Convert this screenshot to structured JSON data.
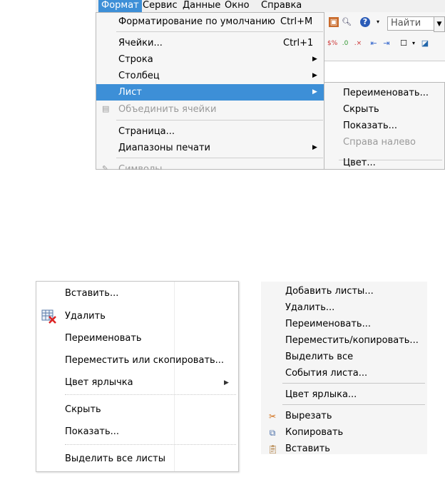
{
  "panel1": {
    "menubar": [
      {
        "label": "Формат",
        "active": true
      },
      {
        "label": "Сервис"
      },
      {
        "label": "Данные"
      },
      {
        "label": "Окно"
      },
      {
        "label": "Справка"
      }
    ],
    "find_placeholder": "Найти",
    "menu_items": [
      {
        "label": "Форматирование по умолчанию",
        "shortcut": "Ctrl+M"
      },
      {
        "label": "Ячейки...",
        "shortcut": "Ctrl+1"
      },
      {
        "label": "Строка"
      },
      {
        "label": "Столбец"
      },
      {
        "label": "Лист"
      },
      {
        "label": "Объединить ячейки"
      },
      {
        "label": "Страница..."
      },
      {
        "label": "Диапазоны печати"
      },
      {
        "label": "Символы"
      }
    ],
    "submenu_items": [
      {
        "label": "Переименовать..."
      },
      {
        "label": "Скрыть"
      },
      {
        "label": "Показать..."
      },
      {
        "label": "Справа налево"
      },
      {
        "label": "Цвет..."
      }
    ]
  },
  "panel2": {
    "items": [
      {
        "label": "Вставить..."
      },
      {
        "label": "Удалить"
      },
      {
        "label": "Переименовать"
      },
      {
        "label": "Переместить или скопировать..."
      },
      {
        "label": "Цвет ярлычка"
      },
      {
        "label": "Скрыть"
      },
      {
        "label": "Показать..."
      },
      {
        "label": "Выделить все листы"
      }
    ]
  },
  "panel3": {
    "items": [
      {
        "label": "Добавить листы..."
      },
      {
        "label": "Удалить..."
      },
      {
        "label": "Переименовать..."
      },
      {
        "label": "Переместить/копировать..."
      },
      {
        "label": "Выделить все"
      },
      {
        "label": "События листа..."
      },
      {
        "label": "Цвет ярлыка..."
      },
      {
        "label": "Вырезать",
        "icon": "scissors-icon"
      },
      {
        "label": "Копировать",
        "icon": "copy-icon"
      },
      {
        "label": "Вставить",
        "icon": "paste-icon"
      }
    ]
  },
  "colors": {
    "highlight": "#3d8fd7",
    "disabled_text": "#9a9a9a",
    "menu_bg": "#f6f6f6"
  }
}
